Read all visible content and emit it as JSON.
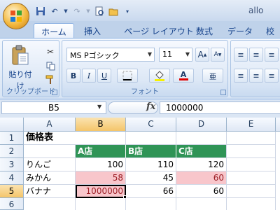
{
  "window": {
    "title": "allo"
  },
  "quick_access": [
    "save-icon",
    "undo-icon",
    "redo-icon",
    "print-preview-icon",
    "open-folder-icon",
    "customize-icon"
  ],
  "tabs": [
    {
      "label": "ホーム",
      "active": true
    },
    {
      "label": "挿入"
    },
    {
      "label": "ページ レイアウト"
    },
    {
      "label": "数式"
    },
    {
      "label": "データ"
    },
    {
      "label": "校"
    }
  ],
  "clipboard": {
    "paste_label": "貼り付け",
    "group_label": "クリップボード"
  },
  "font": {
    "name": "MS Pゴシック",
    "size": "11",
    "group_label": "フォント",
    "bold": "B",
    "italic": "I",
    "underline": "U",
    "grow": "A",
    "shrink": "A",
    "color_letter": "A",
    "phonetic": "亜"
  },
  "formula_bar": {
    "name_box": "B5",
    "fx_label": "fx",
    "value": "1000000"
  },
  "colors": {
    "header_green": "#2f9456",
    "pink_fill": "#f8c6cb",
    "pink_text": "#9b1d24"
  },
  "sheet": {
    "columns": [
      "A",
      "B",
      "C",
      "D",
      "E"
    ],
    "rows": [
      "1",
      "2",
      "3",
      "4",
      "5",
      "6"
    ],
    "cells": {
      "A1": "価格表",
      "B2": "A店",
      "C2": "B店",
      "D2": "C店",
      "A3": "りんご",
      "B3": "100",
      "C3": "110",
      "D3": "120",
      "A4": "みかん",
      "B4": "58",
      "C4": "45",
      "D4": "60",
      "A5": "バナナ",
      "B5": "1000000",
      "C5": "66",
      "D5": "60"
    },
    "active_cell": "B5"
  }
}
